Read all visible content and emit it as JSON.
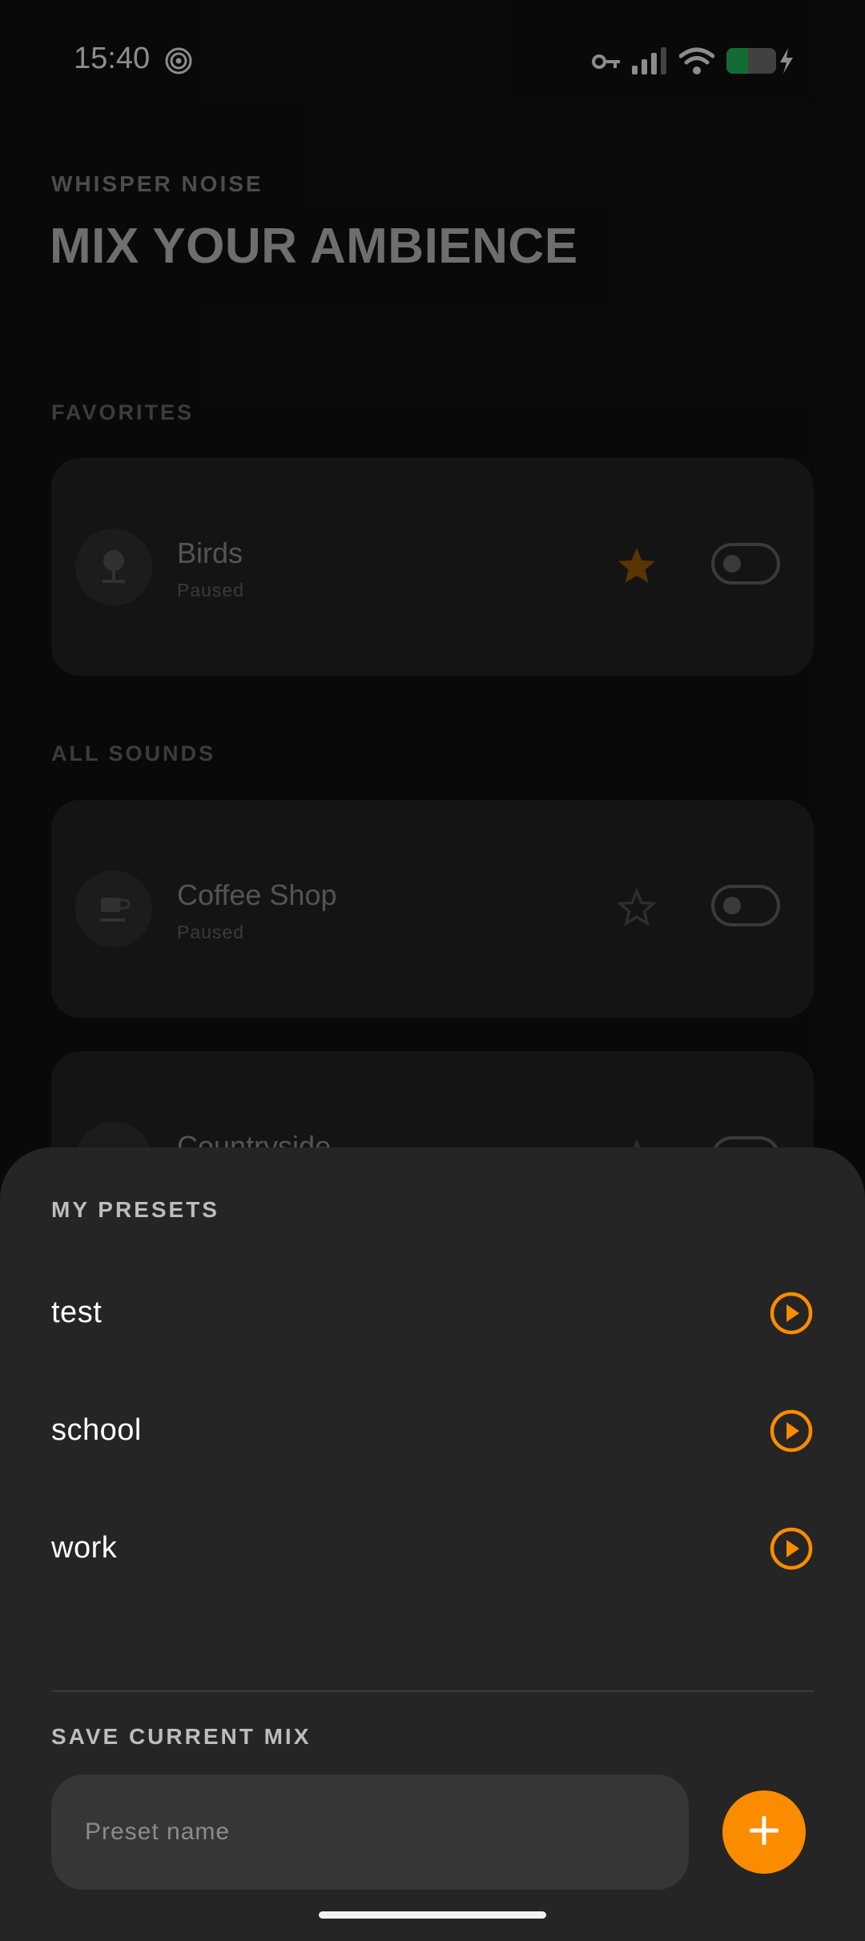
{
  "status_bar": {
    "time": "15:40",
    "icons": [
      "radar-icon",
      "vpn-key-icon",
      "signal-icon",
      "wifi-icon",
      "battery-charging-icon"
    ]
  },
  "header": {
    "app_name": "WHISPER NOISE",
    "title": "MIX YOUR AMBIENCE"
  },
  "favorites": {
    "label": "FAVORITES",
    "items": [
      {
        "name": "Birds",
        "status": "Paused",
        "icon": "tree-icon",
        "favorite": true,
        "enabled": false
      }
    ]
  },
  "all_sounds": {
    "label": "ALL SOUNDS",
    "items": [
      {
        "name": "Coffee Shop",
        "status": "Paused",
        "icon": "coffee-cup-icon",
        "favorite": false,
        "enabled": false
      },
      {
        "name": "Countryside",
        "status": "",
        "icon": "countryside-icon",
        "favorite": false,
        "enabled": false
      }
    ]
  },
  "presets_sheet": {
    "label": "MY PRESETS",
    "presets": [
      {
        "name": "test"
      },
      {
        "name": "school"
      },
      {
        "name": "work"
      }
    ],
    "save_label": "SAVE CURRENT MIX",
    "input_placeholder": "Preset name",
    "input_value": ""
  },
  "colors": {
    "accent": "#fb8c00",
    "sheet_bg": "#252525",
    "card_bg": "#262626"
  }
}
